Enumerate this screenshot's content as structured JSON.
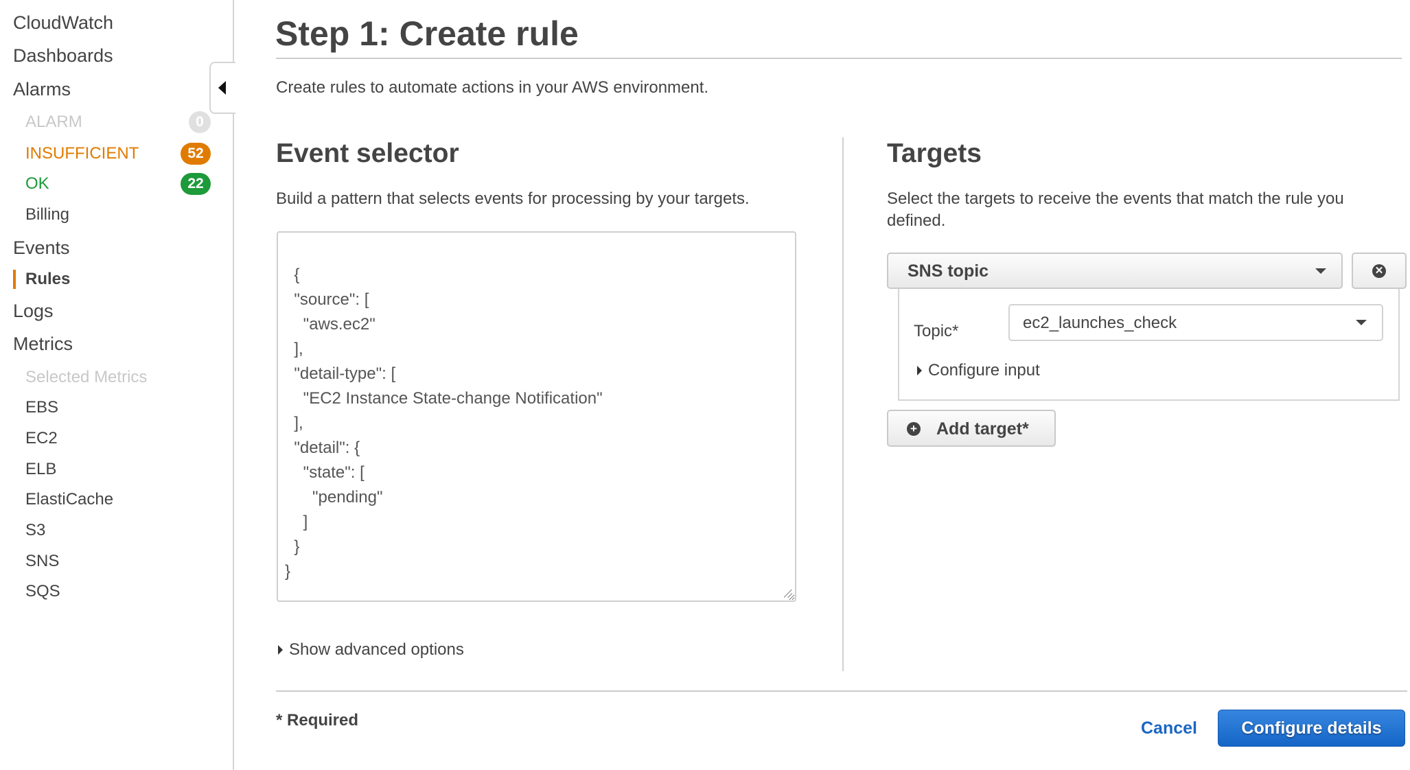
{
  "sidebar": {
    "items": [
      {
        "label": "CloudWatch",
        "level": 0
      },
      {
        "label": "Dashboards",
        "level": 0
      },
      {
        "label": "Alarms",
        "level": 0
      },
      {
        "label": "ALARM",
        "level": 1,
        "badge": "0",
        "state": "muted"
      },
      {
        "label": "INSUFFICIENT",
        "level": 1,
        "badge": "52",
        "state": "warning"
      },
      {
        "label": "OK",
        "level": 1,
        "badge": "22",
        "state": "ok"
      },
      {
        "label": "Billing",
        "level": 1
      },
      {
        "label": "Events",
        "level": 0
      },
      {
        "label": "Rules",
        "level": 1,
        "active": true
      },
      {
        "label": "Logs",
        "level": 0
      },
      {
        "label": "Metrics",
        "level": 0
      },
      {
        "label": "Selected Metrics",
        "level": 1,
        "state": "muted"
      },
      {
        "label": "EBS",
        "level": 1
      },
      {
        "label": "EC2",
        "level": 1
      },
      {
        "label": "ELB",
        "level": 1
      },
      {
        "label": "ElastiCache",
        "level": 1
      },
      {
        "label": "S3",
        "level": 1
      },
      {
        "label": "SNS",
        "level": 1
      },
      {
        "label": "SQS",
        "level": 1
      }
    ],
    "collapse_icon": "caret-left-icon"
  },
  "colors": {
    "accent_orange": "#e07b00",
    "ok_green": "#1d9a3a",
    "muted_gray": "#c8c8c8",
    "primary_blue": "#1565c6",
    "link_blue": "#1a66c2"
  },
  "header": {
    "title": "Step 1: Create rule",
    "subtitle": "Create rules to automate actions in your AWS environment."
  },
  "event_selector": {
    "title": "Event selector",
    "description": "Build a pattern that selects events for processing by your targets.",
    "pattern": "{\n  \"source\": [\n    \"aws.ec2\"\n  ],\n  \"detail-type\": [\n    \"EC2 Instance State-change Notification\"\n  ],\n  \"detail\": {\n    \"state\": [\n      \"pending\"\n    ]\n  }\n}",
    "advanced_label": "Show advanced options"
  },
  "targets": {
    "title": "Targets",
    "description": "Select the targets to receive the events that match the rule you defined.",
    "target_type": "SNS topic",
    "topic_label": "Topic*",
    "topic_value": "ec2_launches_check",
    "configure_input_label": "Configure input",
    "add_target_label": "Add target*",
    "remove_icon": "x-circle-icon",
    "add_icon": "plus-circle-icon"
  },
  "footer": {
    "required_note": "* Required",
    "cancel_label": "Cancel",
    "primary_label": "Configure details"
  }
}
